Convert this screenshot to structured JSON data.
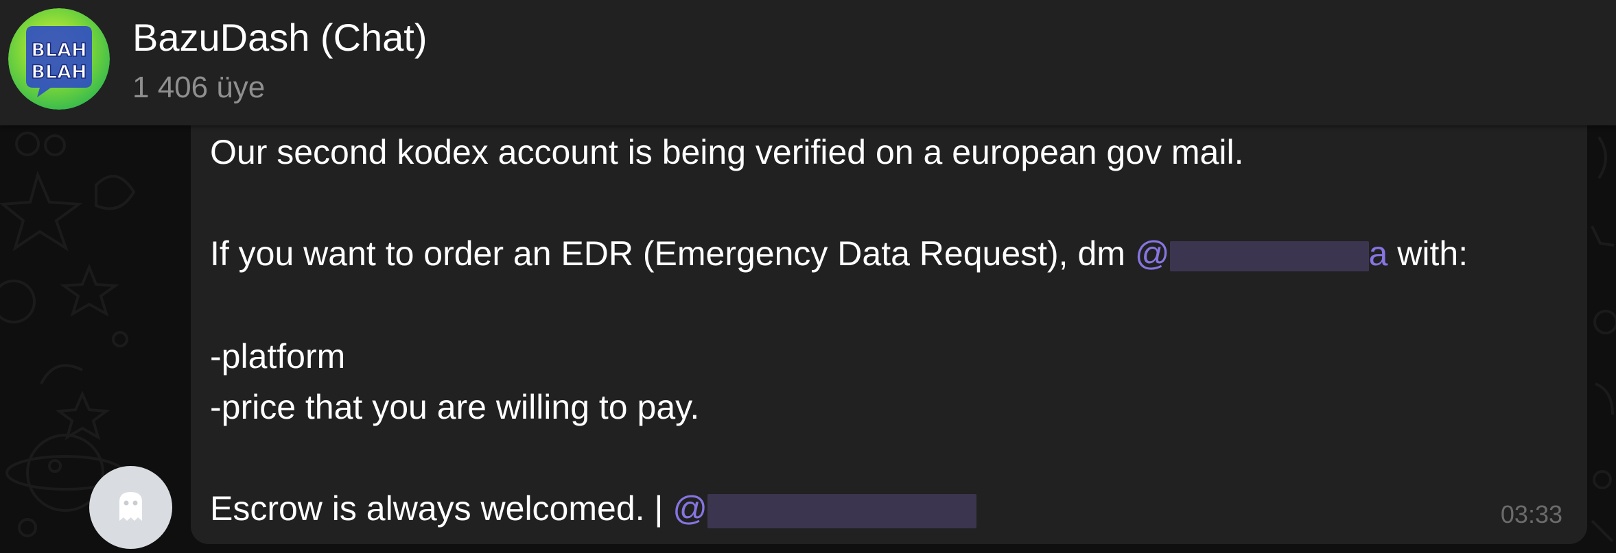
{
  "header": {
    "title": "BazuDash (Chat)",
    "members": "1 406 üye",
    "avatar_text_line1": "BLAH",
    "avatar_text_line2": "BLAH"
  },
  "message": {
    "line1": "Our second kodex account is being verified on a european gov mail.",
    "line2_before": "If you want to order an EDR (Emergency Data Request), dm ",
    "line2_mention_at": "@",
    "line2_mention_tail": "a",
    "line2_after": " with:",
    "line3": "-platform",
    "line4": "-price that you are willing to pay.",
    "line5_before": "Escrow is always welcomed. | ",
    "line5_mention_at": "@",
    "time": "03:33"
  },
  "colors": {
    "mention": "#8774e1",
    "bubble": "#212121",
    "header": "#212121",
    "background": "#0f0f0f"
  },
  "icons": {
    "group_avatar": "blah-blah-speech-bubble-icon",
    "sender_avatar": "ghost-icon"
  }
}
